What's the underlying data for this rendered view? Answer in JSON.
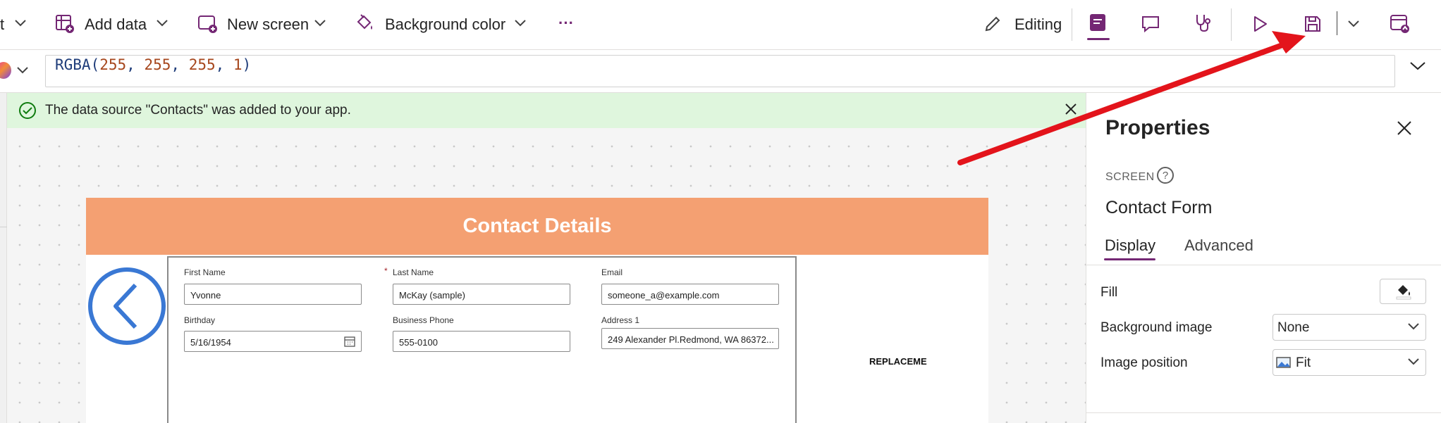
{
  "toolbar": {
    "insert_label_fragment": "t",
    "add_data_label": "Add data",
    "new_screen_label": "New screen",
    "background_color_label": "Background color",
    "more_label": "···",
    "editing_label": "Editing"
  },
  "formula_bar": {
    "expression_prefix": "RGBA(",
    "values": [
      "255",
      "255",
      "255",
      "1"
    ],
    "expression_suffix": ")"
  },
  "notification": {
    "message": "The data source \"Contacts\" was added to your app."
  },
  "app_screen": {
    "header_title": "Contact Details",
    "fields": [
      {
        "label": "First Name",
        "value": "Yvonne"
      },
      {
        "label": "Last Name",
        "value": "McKay (sample)",
        "required_marker": "*"
      },
      {
        "label": "Email",
        "value": "someone_a@example.com"
      },
      {
        "label": "Birthday",
        "value": "5/16/1954"
      },
      {
        "label": "Business Phone",
        "value": "555-0100"
      },
      {
        "label": "Address 1",
        "value": "249 Alexander Pl.Redmond, WA 86372..."
      }
    ],
    "placeholder_text": "REPLACEME"
  },
  "properties_panel": {
    "title": "Properties",
    "type_label": "SCREEN",
    "help_glyph": "?",
    "screen_name": "Contact Form",
    "tabs": [
      {
        "label": "Display",
        "active": true
      },
      {
        "label": "Advanced",
        "active": false
      }
    ],
    "rows": [
      {
        "label": "Fill"
      },
      {
        "label": "Background image",
        "value": "None"
      },
      {
        "label": "Image position",
        "value": "Fit"
      }
    ]
  },
  "colors": {
    "brand_purple": "#742774",
    "header_orange": "#f4a072",
    "success_green_bg": "#dff6dd",
    "success_green_icon": "#107c10",
    "annotation_arrow_red": "#e3141b",
    "back_circle_blue": "#3a78d4"
  }
}
